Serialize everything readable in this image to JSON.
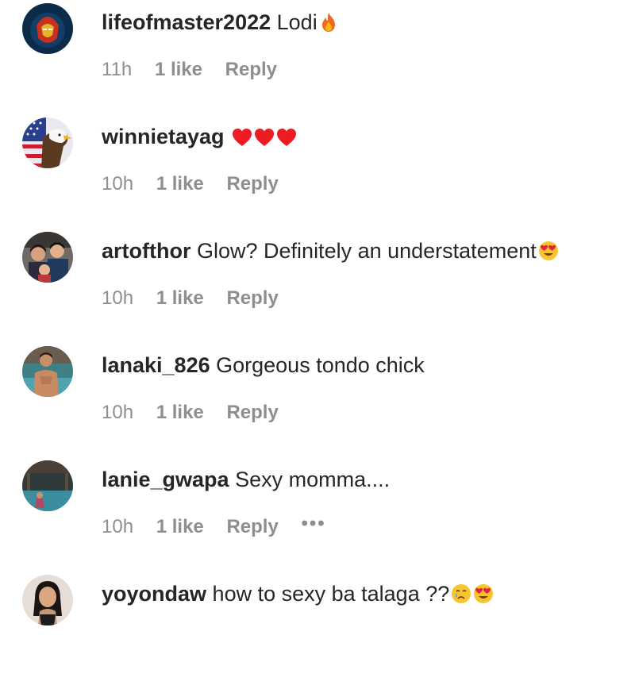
{
  "comments": [
    {
      "username": "lifeofmaster2022",
      "text": "Lodi",
      "emoji": [
        "fire"
      ],
      "time": "11h",
      "likes": "1 like",
      "reply": "Reply"
    },
    {
      "username": "winnietayag",
      "text": "",
      "emoji": [
        "heart",
        "heart",
        "heart"
      ],
      "time": "10h",
      "likes": "1 like",
      "reply": "Reply"
    },
    {
      "username": "artofthor",
      "text": "Glow? Definitely an understatement",
      "emoji": [
        "heart-eyes"
      ],
      "time": "10h",
      "likes": "1 like",
      "reply": "Reply"
    },
    {
      "username": "lanaki_826",
      "text": "Gorgeous tondo chick",
      "emoji": [],
      "time": "10h",
      "likes": "1 like",
      "reply": "Reply"
    },
    {
      "username": "lanie_gwapa",
      "text": "Sexy momma....",
      "emoji": [],
      "time": "10h",
      "likes": "1 like",
      "reply": "Reply",
      "more": "•••"
    },
    {
      "username": "yoyondaw",
      "text": "how to sexy ba talaga ??",
      "emoji": [
        "crying",
        "heart-eyes"
      ],
      "time": "",
      "likes": "",
      "reply": ""
    }
  ],
  "colors": {
    "text": "#262626",
    "meta": "#8e8e8e",
    "heart": "#ed1c24",
    "emoji_face": "#f7c531"
  }
}
